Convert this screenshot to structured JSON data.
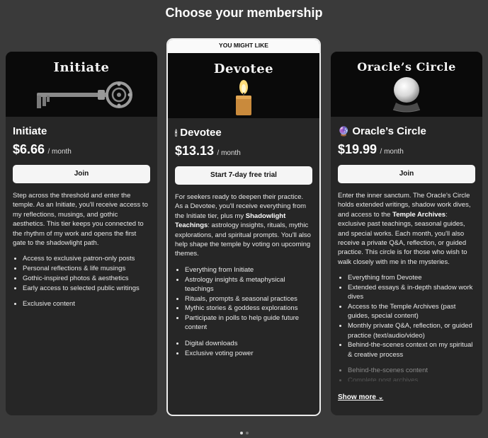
{
  "page": {
    "title": "Choose your membership"
  },
  "tiers": [
    {
      "hero_title": "Initiate",
      "name": "Initiate",
      "icon": "",
      "price": "$6.66",
      "period": "/ month",
      "button": "Join",
      "description": "Step across the threshold and enter the temple. As an Initiate, you'll receive access to my reflections, musings, and gothic aesthetics. This tier keeps you connected to the rhythm of my work and opens the first gate to the shadowlight path.",
      "benefits": [
        "Access to exclusive patron-only posts",
        "Personal reflections & life musings",
        "Gothic-inspired photos & aesthetics",
        "Early access to selected public writings"
      ],
      "extras": [
        "Exclusive content"
      ]
    },
    {
      "badge": "YOU MIGHT LIKE",
      "hero_title": "Devotee",
      "name": "Devotee",
      "icon": "🕯",
      "price": "$13.13",
      "period": "/ month",
      "button": "Start 7-day free trial",
      "description_1": "For seekers ready to deepen their practice. As a Devotee, you'll receive everything from the Initiate tier, plus my ",
      "description_bold": "Shadowlight Teachings",
      "description_2": ": astrology insights, rituals, mythic explorations, and spiritual prompts. You'll also help shape the temple by voting on upcoming themes.",
      "benefits": [
        "Everything from Initiate",
        "Astrology insights & metaphysical teachings",
        "Rituals, prompts & seasonal practices",
        "Mythic stories & goddess explorations",
        "Participate in polls to help guide future content"
      ],
      "extras": [
        "Digital downloads",
        "Exclusive voting power"
      ]
    },
    {
      "hero_title": "Oracle’s Circle",
      "name": "Oracle’s Circle",
      "icon": "🔮",
      "price": "$19.99",
      "period": "/ month",
      "button": "Join",
      "description_1": "Enter the inner sanctum. The Oracle's Circle holds extended writings, shadow work dives, and access to the ",
      "description_bold": "Temple Archives",
      "description_2": ": exclusive past teachings, seasonal guides, and special works. Each month, you'll also receive a private Q&A, reflection, or guided practice. This circle is for those who wish to walk closely with me in the mysteries.",
      "benefits": [
        "Everything from Devotee",
        "Extended essays & in-depth shadow work dives",
        "Access to the Temple Archives (past guides, special content)",
        "Monthly private Q&A, reflection, or guided practice (text/audio/video)",
        "Behind-the-scenes context on my spiritual & creative process"
      ],
      "extras": [
        "Behind-the-scenes content",
        "Complete post archives"
      ],
      "show_more": "Show more"
    }
  ],
  "pagination": {
    "total": 2,
    "active": 1
  }
}
